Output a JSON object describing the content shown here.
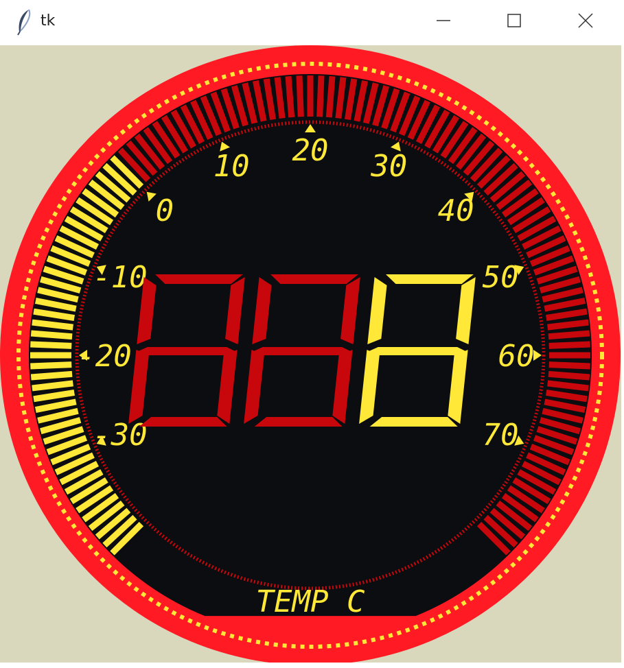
{
  "window": {
    "title": "tk"
  },
  "icons": {
    "app": "feather-icon",
    "minimize": "minimize-icon",
    "maximize": "maximize-icon",
    "close": "close-icon"
  },
  "gauge": {
    "unit_label": "TEMP C",
    "display_digits": "888",
    "value": 0,
    "scale_min": -40,
    "scale_max": 80,
    "tick_labels": [
      "-30",
      "-20",
      "-10",
      "0",
      "10",
      "20",
      "30",
      "40",
      "50",
      "60",
      "70"
    ],
    "colors": {
      "face": "#0c0d10",
      "rim": "#ff1a24",
      "active": "#ffe838",
      "inactive": "#c8070c",
      "canvas": "#d9d8bd"
    }
  }
}
